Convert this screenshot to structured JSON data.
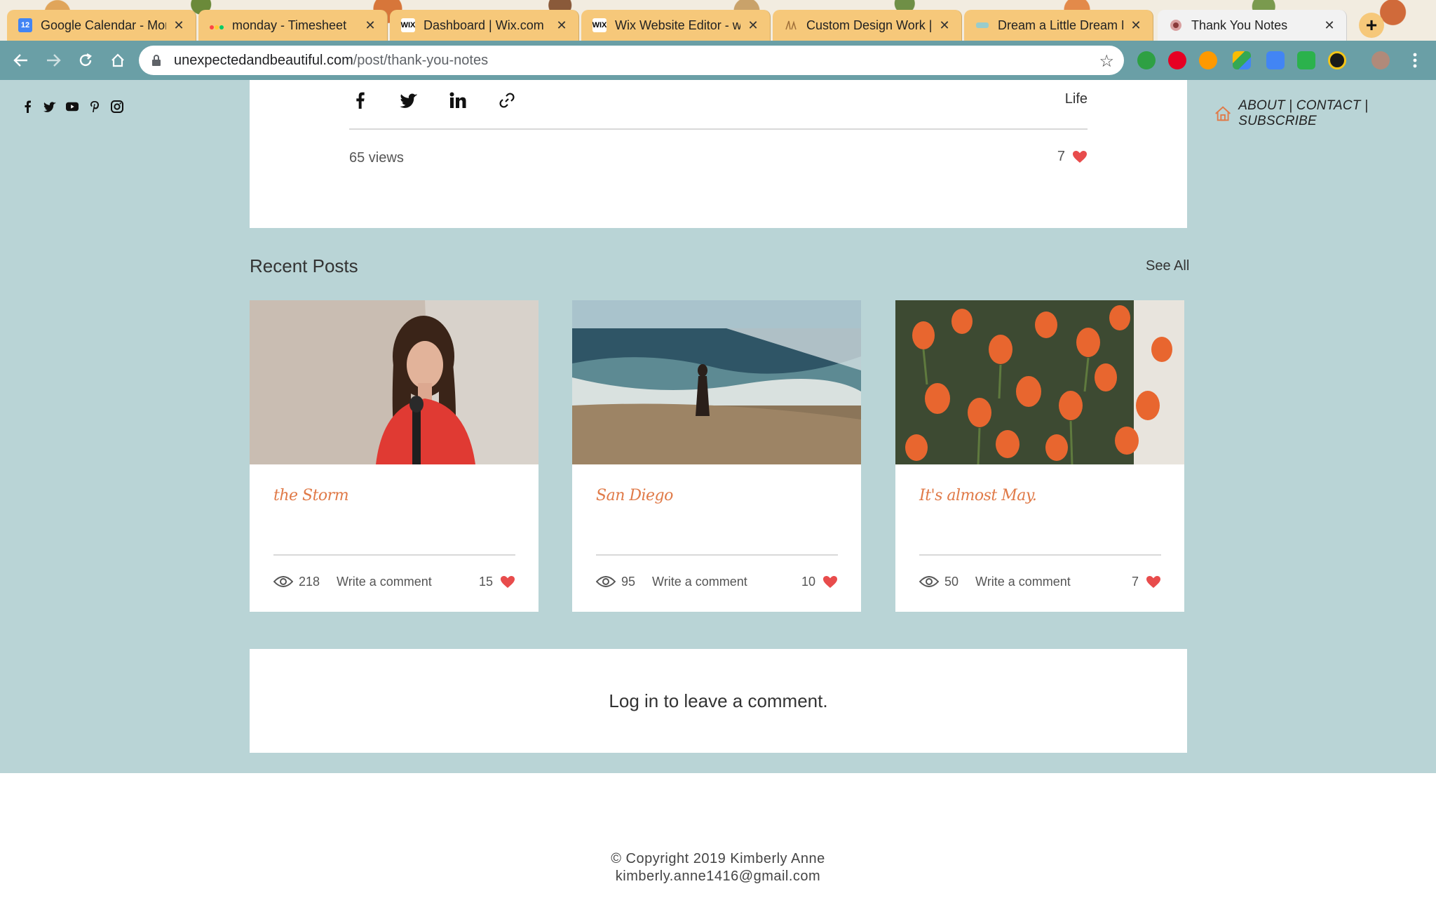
{
  "browser": {
    "tabs": [
      {
        "title": "Google Calendar - Mor",
        "favicon": "calendar-icon",
        "favicon_text": "12",
        "favicon_color": "#4285f4"
      },
      {
        "title": "monday - Timesheet",
        "favicon": "monday-icon",
        "favicon_text": "",
        "favicon_color": "#f6c87a"
      },
      {
        "title": "Dashboard | Wix.com",
        "favicon": "wix-icon",
        "favicon_text": "WIX",
        "favicon_color": "#ffffff"
      },
      {
        "title": "Wix Website Editor - w",
        "favicon": "wix-icon",
        "favicon_text": "WIX",
        "favicon_color": "#ffffff"
      },
      {
        "title": "Custom Design Work |",
        "favicon": "design-icon",
        "favicon_text": "",
        "favicon_color": "#f6c87a"
      },
      {
        "title": "Dream a Little Dream F",
        "favicon": "dream-icon",
        "favicon_text": "",
        "favicon_color": "#f6c87a"
      },
      {
        "title": "Thank You Notes",
        "favicon": "thank-you-icon",
        "favicon_text": "",
        "favicon_color": "#f2f2f2"
      }
    ],
    "close_glyph": "✕",
    "new_tab_glyph": "+",
    "url_domain": "unexpectedandbeautiful.com",
    "url_path": "/post/thank-you-notes",
    "bookmark_glyph": "☆"
  },
  "site": {
    "nav_links": "ABOUT | CONTACT | SUBSCRIBE",
    "social_icons": [
      "facebook-icon",
      "twitter-icon",
      "youtube-icon",
      "pinterest-icon",
      "instagram-icon"
    ]
  },
  "post": {
    "category": "Life",
    "views": "65 views",
    "likes": "7"
  },
  "recent": {
    "title": "Recent Posts",
    "see_all": "See All",
    "items": [
      {
        "title": "the Storm",
        "views": "218",
        "comment": "Write a comment",
        "likes": "15"
      },
      {
        "title": "San Diego",
        "views": "95",
        "comment": "Write a comment",
        "likes": "10"
      },
      {
        "title": "It's almost May.",
        "views": "50",
        "comment": "Write a comment",
        "likes": "7"
      }
    ]
  },
  "comments": {
    "login_prompt": "Log in to leave a comment."
  },
  "footer": {
    "copyright": "© Copyright 2019 Kimberly Anne",
    "email": "kimberly.anne1416@gmail.com"
  },
  "colors": {
    "page_bg": "#b9d4d6",
    "toolbar": "#6a9fa6",
    "tab": "#f6c87a",
    "heart": "#e84c4c",
    "script_title": "#e07a48"
  }
}
